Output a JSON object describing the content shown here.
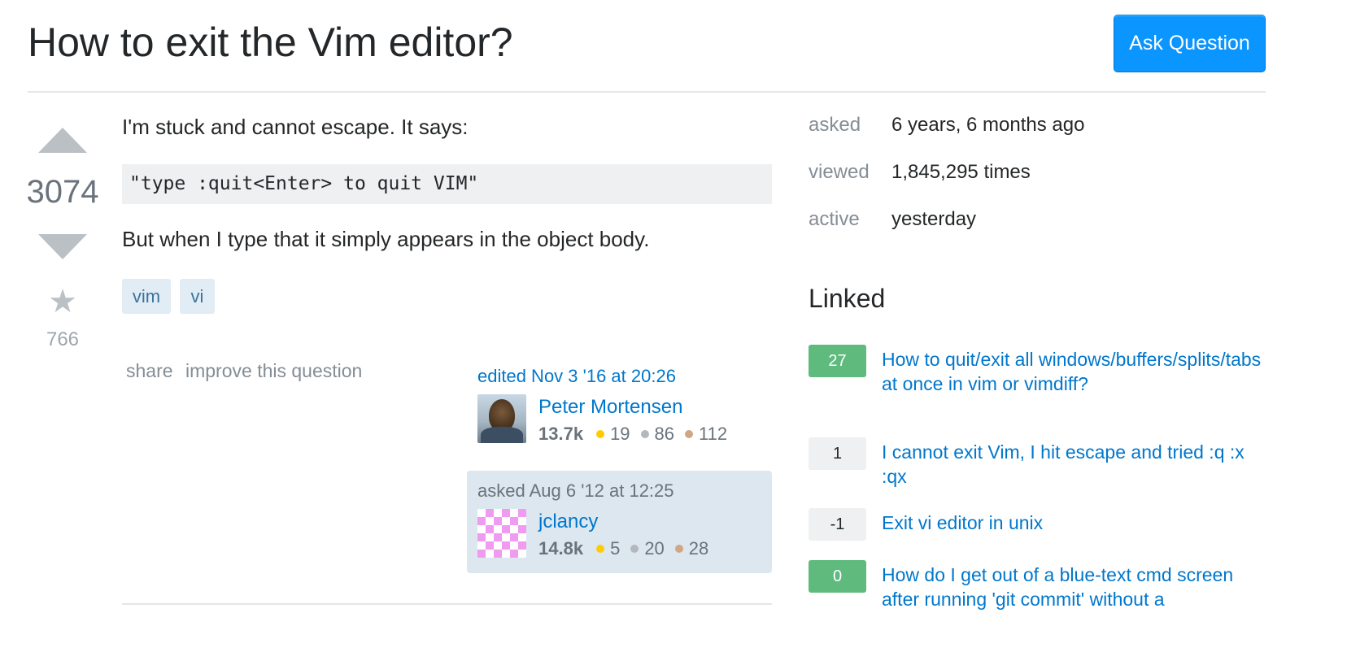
{
  "header": {
    "title": "How to exit the Vim editor?",
    "ask_button": "Ask Question"
  },
  "question": {
    "votes": "3074",
    "favorites": "766",
    "intro": "I'm stuck and cannot escape. It says:",
    "code": "\"type :quit<Enter> to quit VIM\"",
    "body": "But when I type that it simply appears in the object body.",
    "tags": [
      "vim",
      "vi"
    ],
    "menu": {
      "share": "share",
      "improve": "improve this question"
    }
  },
  "editor": {
    "action": "edited Nov 3 '16 at 20:26",
    "name": "Peter Mortensen",
    "reputation": "13.7k",
    "gold": "19",
    "silver": "86",
    "bronze": "112"
  },
  "asker": {
    "action": "asked Aug 6 '12 at 12:25",
    "name": "jclancy",
    "reputation": "14.8k",
    "gold": "5",
    "silver": "20",
    "bronze": "28"
  },
  "stats": {
    "asked_label": "asked",
    "asked_value": "6 years, 6 months ago",
    "viewed_label": "viewed",
    "viewed_value": "1,845,295 times",
    "active_label": "active",
    "active_value": "yesterday"
  },
  "linked": {
    "heading": "Linked",
    "items": [
      {
        "score": "27",
        "title": "How to quit/exit all windows/buffers/splits/tabs at once in vim or vimdiff?",
        "accepted": true
      },
      {
        "score": "1",
        "title": "I cannot exit Vim, I hit escape and tried :q :x :qx",
        "accepted": false
      },
      {
        "score": "-1",
        "title": "Exit vi editor in unix",
        "accepted": false
      },
      {
        "score": "0",
        "title": "How do I get out of a blue-text cmd screen after running 'git commit' without a",
        "accepted": true
      }
    ]
  },
  "colors": {
    "accent": "#0a95ff",
    "link": "#0077cc",
    "accepted_score": "#5eba7d",
    "tag_bg": "#e1ecf4",
    "tag_text": "#39739d",
    "owner_card_bg": "#dce7f0",
    "badge_gold": "#ffcc01",
    "badge_silver": "#b4b8bc",
    "badge_bronze": "#d1a684"
  },
  "icons": {
    "vote_up": "vote-up-arrow-icon",
    "vote_down": "vote-down-arrow-icon",
    "favorite": "star-icon"
  }
}
